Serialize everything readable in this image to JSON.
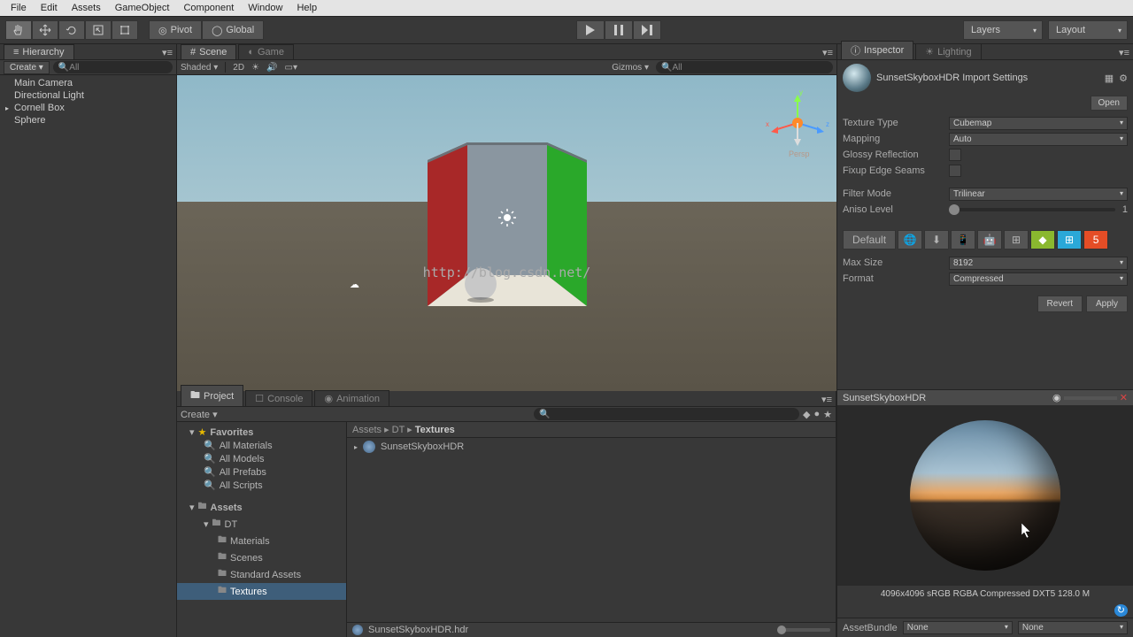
{
  "menu": [
    "File",
    "Edit",
    "Assets",
    "GameObject",
    "Component",
    "Window",
    "Help"
  ],
  "toolbar": {
    "pivot_label": "Pivot",
    "global_label": "Global",
    "layers_label": "Layers",
    "layout_label": "Layout"
  },
  "hierarchy": {
    "tab": "Hierarchy",
    "create": "Create",
    "search_placeholder": "All",
    "items": [
      "Main Camera",
      "Directional Light",
      "Cornell Box",
      "Sphere"
    ]
  },
  "scene": {
    "tab_scene": "Scene",
    "tab_game": "Game",
    "shading": "Shaded",
    "mode2d": "2D",
    "gizmos": "Gizmos",
    "search_placeholder": "All",
    "axis": {
      "x": "x",
      "y": "y",
      "z": "z"
    },
    "persp": "Persp",
    "watermark": "http://blog.csdn.net/"
  },
  "project": {
    "tab_project": "Project",
    "tab_console": "Console",
    "tab_animation": "Animation",
    "create": "Create",
    "favorites_label": "Favorites",
    "favorites": [
      "All Materials",
      "All Models",
      "All Prefabs",
      "All Scripts"
    ],
    "assets_label": "Assets",
    "folders": {
      "dt": "DT",
      "materials": "Materials",
      "scenes": "Scenes",
      "standard": "Standard Assets",
      "textures": "Textures"
    },
    "breadcrumb": [
      "Assets",
      "DT",
      "Textures"
    ],
    "asset_name": "SunsetSkyboxHDR",
    "footer_file": "SunsetSkyboxHDR.hdr"
  },
  "inspector": {
    "tab_inspector": "Inspector",
    "tab_lighting": "Lighting",
    "title": "SunsetSkyboxHDR Import Settings",
    "open": "Open",
    "props": {
      "texture_type": {
        "label": "Texture Type",
        "value": "Cubemap"
      },
      "mapping": {
        "label": "Mapping",
        "value": "Auto"
      },
      "glossy": {
        "label": "Glossy Reflection"
      },
      "fixup": {
        "label": "Fixup Edge Seams"
      },
      "filter_mode": {
        "label": "Filter Mode",
        "value": "Trilinear"
      },
      "aniso": {
        "label": "Aniso Level",
        "value": "1"
      },
      "default": "Default",
      "max_size": {
        "label": "Max Size",
        "value": "8192"
      },
      "format": {
        "label": "Format",
        "value": "Compressed"
      }
    },
    "revert": "Revert",
    "apply": "Apply"
  },
  "preview": {
    "title": "SunsetSkyboxHDR",
    "info": "4096x4096 sRGB  RGBA Compressed DXT5  128.0 M",
    "assetbundle_label": "AssetBundle",
    "assetbundle_value": "None",
    "variant_value": "None"
  }
}
